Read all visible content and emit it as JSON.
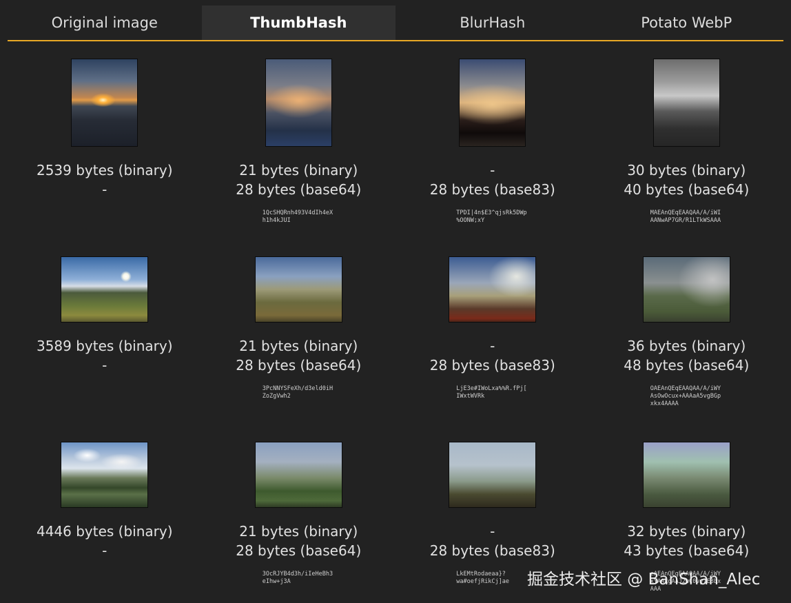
{
  "tabs": [
    {
      "label": "Original image",
      "active": false
    },
    {
      "label": "ThumbHash",
      "active": true
    },
    {
      "label": "BlurHash",
      "active": false
    },
    {
      "label": "Potato WebP",
      "active": false
    }
  ],
  "rows": [
    {
      "original": {
        "line1": "2539 bytes (binary)",
        "line2": "-"
      },
      "thumbhash": {
        "line1": "21 bytes (binary)",
        "line2": "28 bytes (base64)",
        "hash": "1QcSHQRnh493V4dIh4eX\nh1h4kJUI"
      },
      "blurhash": {
        "line1": "-",
        "line2": "28 bytes (base83)",
        "hash": "TPDI|4n$E3^qjsRk5DWp\n%OONW;xY"
      },
      "potato": {
        "line1": "30 bytes (binary)",
        "line2": "40 bytes (base64)",
        "hash": "MAEAnQEqEAAQAA/A/iWI\nAANwAP7GR/R1LTkWSAAA"
      }
    },
    {
      "original": {
        "line1": "3589 bytes (binary)",
        "line2": "-"
      },
      "thumbhash": {
        "line1": "21 bytes (binary)",
        "line2": "28 bytes (base64)",
        "hash": "3PcNNYSFeXh/d3eld0iH\nZoZgVwh2"
      },
      "blurhash": {
        "line1": "-",
        "line2": "28 bytes (base83)",
        "hash": "LjE3e#IWoLxa%%R.fPj[\nIWxtWVRk"
      },
      "potato": {
        "line1": "36 bytes (binary)",
        "line2": "48 bytes (base64)",
        "hash": "OAEAnQEqEAAQAA/A/iWY\nAsOwOcux+AAAaA5vgBGp\nxkx4AAAA"
      }
    },
    {
      "original": {
        "line1": "4446 bytes (binary)",
        "line2": "-"
      },
      "thumbhash": {
        "line1": "21 bytes (binary)",
        "line2": "28 bytes (base64)",
        "hash": "3OcRJYB4d3h/iIeHeBh3\neIhw+j3A"
      },
      "blurhash": {
        "line1": "-",
        "line2": "28 bytes (base83)",
        "hash": "LkEMtRodaeaa}?\nwa#oefjRikCj]ae"
      },
      "potato": {
        "line1": "32 bytes (binary)",
        "line2": "43 bytes (base64)",
        "hash": "cAEAnQEqEAAQAA/A/iWY\nxYAAkgAAJ2wC0vy7E8bx\nAAA"
      }
    }
  ],
  "watermark": "掘金技术社区 @ BanShan_Alec"
}
